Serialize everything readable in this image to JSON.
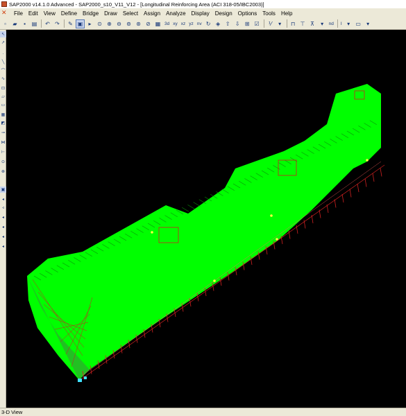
{
  "window": {
    "title": "SAP2000 v14.1.0 Advanced  - SAP2000_s10_V11_V12 - [Longitudinal Reinforcing Area  (ACI 318-05/IBC2003)]"
  },
  "menu": [
    "File",
    "Edit",
    "View",
    "Define",
    "Bridge",
    "Draw",
    "Select",
    "Assign",
    "Analyze",
    "Display",
    "Design",
    "Options",
    "Tools",
    "Help"
  ],
  "toolbar": {
    "view_3d": "3d",
    "view_xy": "xy",
    "view_xz": "xz",
    "view_yz": "yz",
    "view_nv": "nv",
    "view_nd": "nd",
    "section_label": "I"
  },
  "view": {
    "label": "3-D View",
    "background": "#000000",
    "frame_color": "#00ff00",
    "reinforcing_color": "#cc2020",
    "highlight_color": "#ffff40",
    "support_color": "#40e0ff"
  },
  "statusbar": {
    "text": "3-D View"
  }
}
